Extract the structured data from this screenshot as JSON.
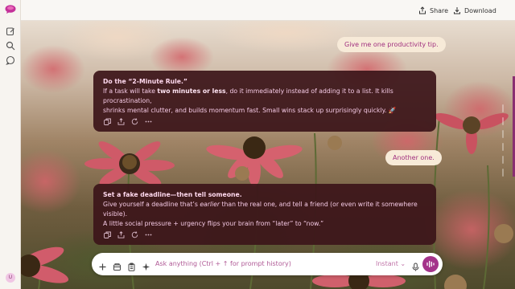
{
  "topbar": {
    "share_label": "Share",
    "download_label": "Download"
  },
  "user_avatar_initial": "U",
  "messages": {
    "user1": "Give me one productivity tip.",
    "ai1": {
      "title": "Do the “2-Minute Rule.”",
      "line1_pre": "If a task will take ",
      "line1_bold": "two minutes or less",
      "line1_post": ", do it immediately instead of adding it to a list. It kills procrastination,",
      "line2": "shrinks mental clutter, and builds momentum fast. Small wins stack up surprisingly quickly. 🚀"
    },
    "user2": "Another one.",
    "ai2": {
      "title": "Set a fake deadline—then tell someone.",
      "line1_pre": "Give yourself a deadline that’s ",
      "line1_em": "earlier",
      "line1_post": " than the real one, and tell a friend (or even write it somewhere visible).",
      "line2": "A little social pressure + urgency flips your brain from “later” to “now.”"
    }
  },
  "composer": {
    "placeholder": "Ask anything (Ctrl + ↑ for prompt history)",
    "mode_label": "Instant"
  },
  "colors": {
    "accent": "#a4338a",
    "card_bg": "#3c161a",
    "user_bubble": "#f7ead8"
  }
}
